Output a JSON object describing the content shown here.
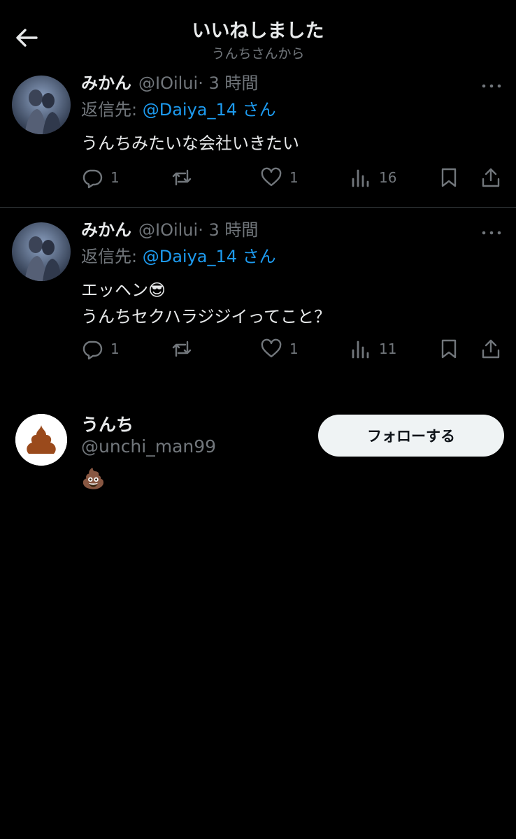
{
  "header": {
    "title": "いいねしました",
    "subtitle": "うんちさんから"
  },
  "tweets": [
    {
      "name": "みかん",
      "handle": "@IOilui",
      "time": "· 3 時間",
      "reply_prefix": "返信先: ",
      "reply_to": "@Daiya_14 さん",
      "text": "うんちみたいな会社いきたい",
      "replies": "1",
      "retweets": "",
      "likes": "1",
      "views": "16"
    },
    {
      "name": "みかん",
      "handle": "@IOilui",
      "time": "· 3 時間",
      "reply_prefix": "返信先: ",
      "reply_to": "@Daiya_14 さん",
      "text": "エッヘン😎\nうんちセクハラジジイってこと？",
      "replies": "1",
      "retweets": "",
      "likes": "1",
      "views": "11"
    }
  ],
  "user": {
    "name": "うんち",
    "handle": "@unchi_man99",
    "bio": "💩",
    "follow_label": "フォローする"
  },
  "colors": {
    "accent": "#1d9bf0",
    "muted": "#71767b",
    "background": "#000000"
  },
  "icons": [
    "arrow-left-icon",
    "more-icon",
    "reply-icon",
    "retweet-icon",
    "like-icon",
    "views-icon",
    "bookmark-icon",
    "share-icon"
  ]
}
